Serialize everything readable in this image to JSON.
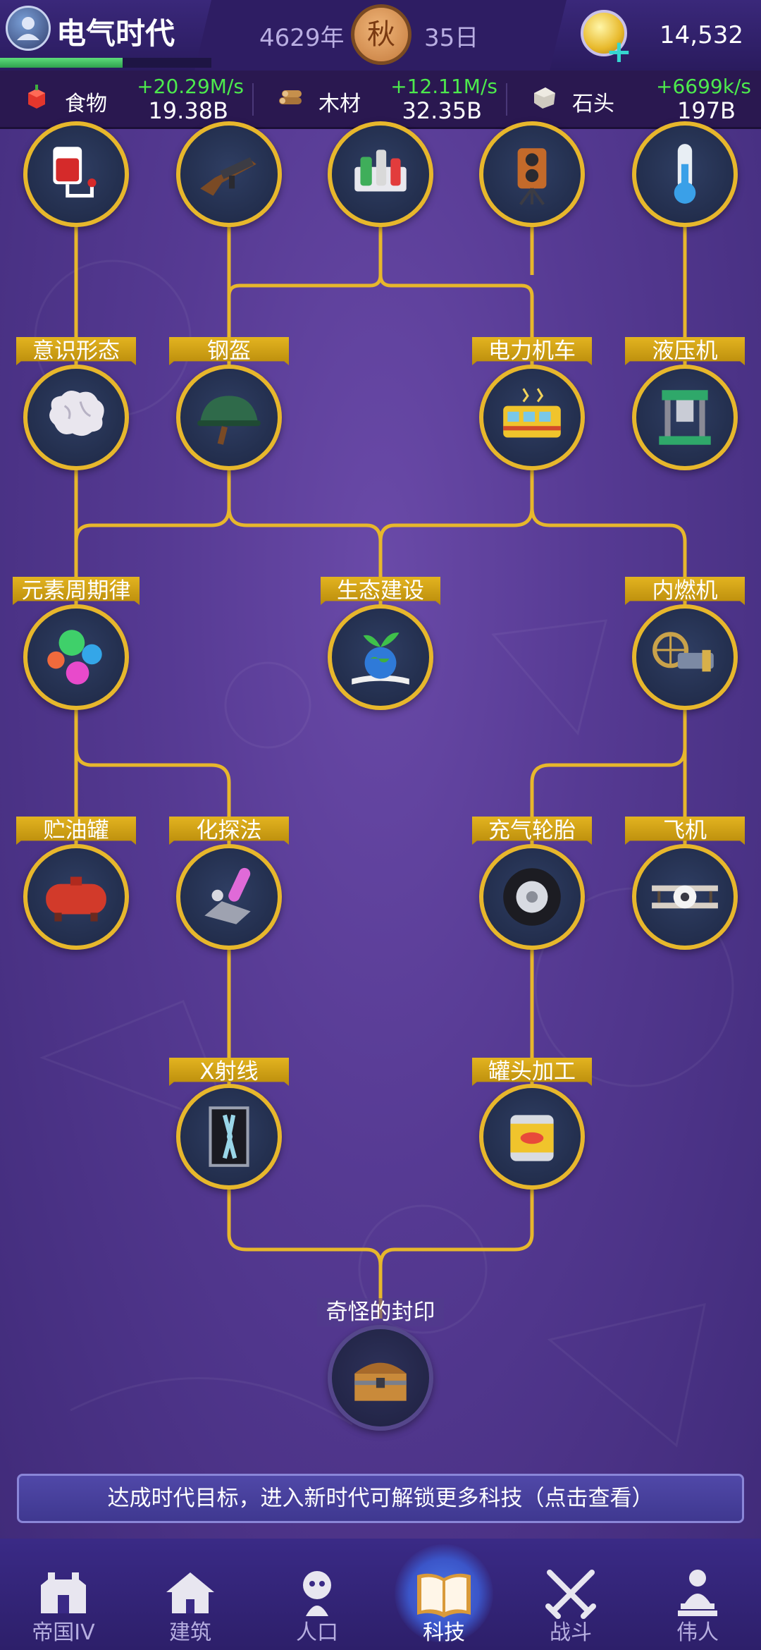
{
  "header": {
    "era_title": "电气时代",
    "year": "4629年",
    "season": "秋",
    "day": "35日",
    "gold": "14,532",
    "era_progress": 0.58
  },
  "resources": [
    {
      "name": "食物",
      "rate": "+20.29M/s",
      "total": "19.38B",
      "icon": "apple-icon"
    },
    {
      "name": "木材",
      "rate": "+12.11M/s",
      "total": "32.35B",
      "icon": "logs-icon"
    },
    {
      "name": "石头",
      "rate": "+6699k/s",
      "total": "197B",
      "icon": "stone-icon"
    }
  ],
  "tech": {
    "row0": [
      {
        "icon": "blood-bag-icon"
      },
      {
        "icon": "submachine-gun-icon"
      },
      {
        "icon": "medicine-bottles-icon"
      },
      {
        "icon": "movie-camera-icon"
      },
      {
        "icon": "thermometer-icon"
      }
    ],
    "nodes": {
      "ideology": {
        "label": "意识形态",
        "icon": "brain-icon"
      },
      "helmet": {
        "label": "钢盔",
        "icon": "helmet-icon"
      },
      "electric_train": {
        "label": "电力机车",
        "icon": "tram-icon"
      },
      "hydraulic_press": {
        "label": "液压机",
        "icon": "press-icon"
      },
      "periodic_law": {
        "label": "元素周期律",
        "icon": "atoms-icon"
      },
      "eco_building": {
        "label": "生态建设",
        "icon": "sprout-globe-icon"
      },
      "combustion_engine": {
        "label": "内燃机",
        "icon": "engine-icon"
      },
      "oil_tank": {
        "label": "贮油罐",
        "icon": "oil-tank-icon"
      },
      "chem_analysis": {
        "label": "化探法",
        "icon": "test-tube-icon"
      },
      "pneumatic_tire": {
        "label": "充气轮胎",
        "icon": "tire-icon"
      },
      "airplane": {
        "label": "飞机",
        "icon": "biplane-icon"
      },
      "xray": {
        "label": "X射线",
        "icon": "xray-icon"
      },
      "canning": {
        "label": "罐头加工",
        "icon": "can-icon"
      },
      "strange_seal": {
        "label": "奇怪的封印",
        "icon": "treasure-chest-icon"
      }
    }
  },
  "goal_button": "达成时代目标，进入新时代可解锁更多科技（点击查看）",
  "nav": [
    {
      "label": "帝国IV",
      "icon": "castle-icon"
    },
    {
      "label": "建筑",
      "icon": "house-icon"
    },
    {
      "label": "人口",
      "icon": "person-icon"
    },
    {
      "label": "科技",
      "icon": "book-icon"
    },
    {
      "label": "战斗",
      "icon": "crossed-swords-icon"
    },
    {
      "label": "伟人",
      "icon": "statue-icon"
    }
  ],
  "colors": {
    "accent": "#e7b72c",
    "rate_green": "#4dea4d",
    "background": "#563a93"
  }
}
